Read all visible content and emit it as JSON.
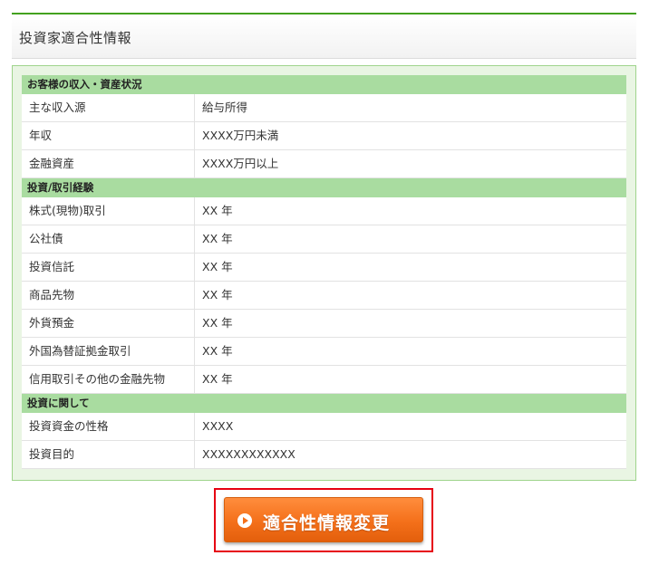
{
  "header": {
    "title": "投資家適合性情報"
  },
  "sections": [
    {
      "title": "お客様の収入・資産状況",
      "rows": [
        {
          "label": "主な収入源",
          "value": "給与所得"
        },
        {
          "label": "年収",
          "value": "XXXX万円未満"
        },
        {
          "label": "金融資産",
          "value": "XXXX万円以上"
        }
      ]
    },
    {
      "title": "投資/取引経験",
      "rows": [
        {
          "label": "株式(現物)取引",
          "value": "XX 年"
        },
        {
          "label": "公社債",
          "value": "XX 年"
        },
        {
          "label": "投資信託",
          "value": "XX 年"
        },
        {
          "label": "商品先物",
          "value": "XX 年"
        },
        {
          "label": "外貨預金",
          "value": "XX 年"
        },
        {
          "label": "外国為替証拠金取引",
          "value": "XX 年"
        },
        {
          "label": "信用取引その他の金融先物",
          "value": "XX 年"
        }
      ]
    },
    {
      "title": "投資に関して",
      "rows": [
        {
          "label": "投資資金の性格",
          "value": "XXXX"
        },
        {
          "label": "投資目的",
          "value": "XXXXXXXXXXXX"
        }
      ]
    }
  ],
  "button": {
    "label": "適合性情報変更",
    "icon": "play-circle-icon",
    "color": "#f4701a",
    "highlight_color": "#e60012"
  }
}
